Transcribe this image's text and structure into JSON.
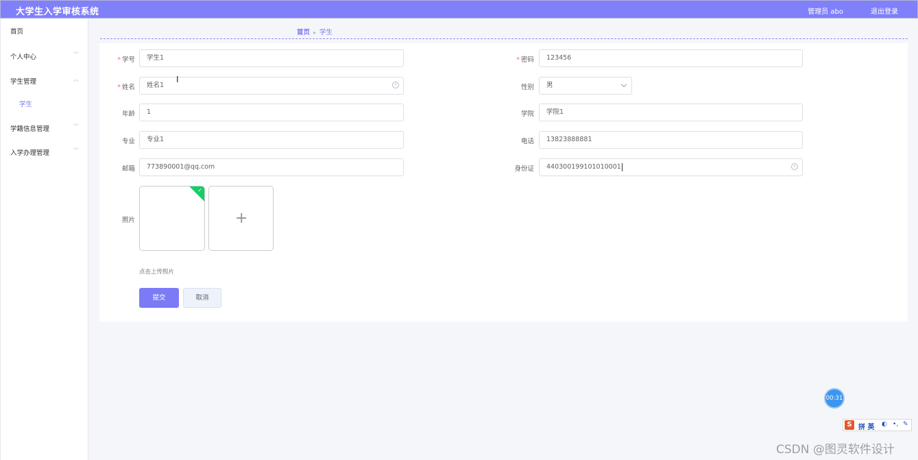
{
  "header": {
    "title": "大学生入学审核系统",
    "admin_label": "管理员 abo",
    "logout_label": "退出登录"
  },
  "sidebar": {
    "items": [
      {
        "label": "首页"
      },
      {
        "label": "个人中心"
      },
      {
        "label": "学生管理"
      },
      {
        "label": "学生"
      },
      {
        "label": "学籍信息管理"
      },
      {
        "label": "入学办理管理"
      }
    ]
  },
  "breadcrumb": {
    "home": "首页",
    "current": "学生"
  },
  "form": {
    "student_no": {
      "label": "学号",
      "value": "学生1"
    },
    "password": {
      "label": "密码",
      "value": "123456"
    },
    "name": {
      "label": "姓名",
      "value": "姓名1"
    },
    "gender": {
      "label": "性别",
      "value": "男"
    },
    "age": {
      "label": "年龄",
      "value": "1"
    },
    "college": {
      "label": "学院",
      "value": "学院1"
    },
    "major": {
      "label": "专业",
      "value": "专业1"
    },
    "phone": {
      "label": "电话",
      "value": "13823888881"
    },
    "email": {
      "label": "邮箱",
      "value": "773890001@qq.com"
    },
    "id_card": {
      "label": "身份证",
      "value": "440300199101010001"
    },
    "photo": {
      "label": "照片",
      "tip": "点击上传照片"
    },
    "submit_label": "提交",
    "cancel_label": "取消",
    "required_mark": "*"
  },
  "overlay": {
    "timer": "00:31",
    "ime_logo": "S",
    "ime_text": "拼 英",
    "watermark": "CSDN @图灵软件设计"
  },
  "colors": {
    "accent": "#8080fb",
    "success": "#13ce66",
    "required": "#f56c6c"
  }
}
